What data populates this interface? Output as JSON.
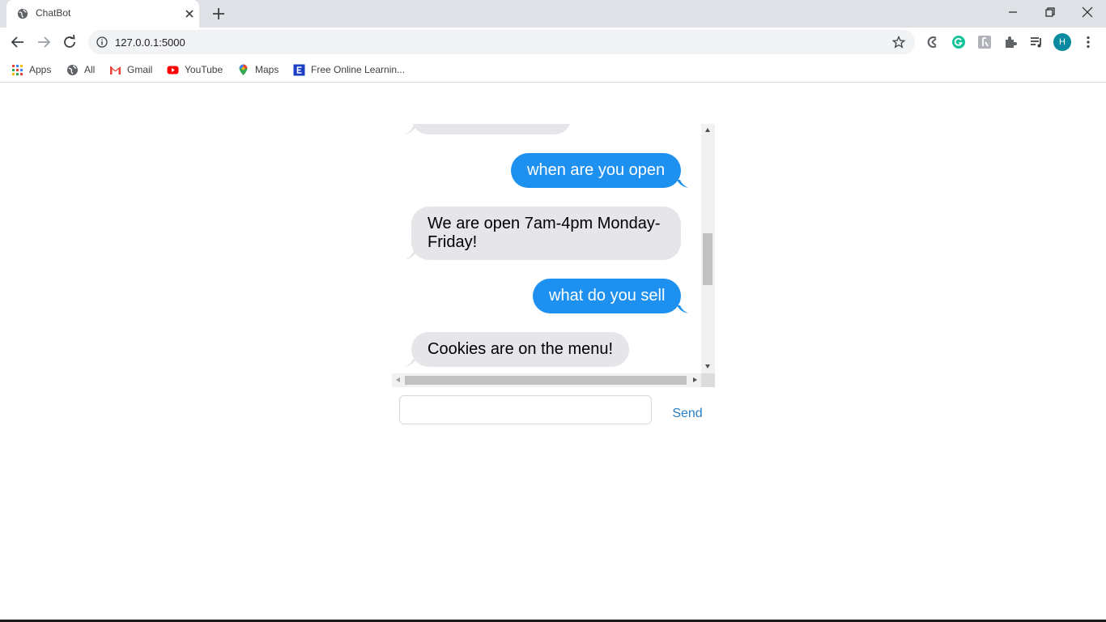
{
  "browser": {
    "tab_title": "ChatBot",
    "url": "127.0.0.1:5000",
    "avatar_letter": "H"
  },
  "bookmarks": [
    {
      "label": "Apps",
      "icon": "apps-grid-icon"
    },
    {
      "label": "All",
      "icon": "globe-icon"
    },
    {
      "label": "Gmail",
      "icon": "gmail-icon"
    },
    {
      "label": "YouTube",
      "icon": "youtube-icon"
    },
    {
      "label": "Maps",
      "icon": "maps-pin-icon"
    },
    {
      "label": "Free Online Learnin...",
      "icon": "learning-site-icon"
    }
  ],
  "chat": {
    "messages": [
      {
        "sender": "bot",
        "text": ""
      },
      {
        "sender": "user",
        "text": "when are you open"
      },
      {
        "sender": "bot",
        "text": "We are open 7am-4pm Monday-Friday!"
      },
      {
        "sender": "user",
        "text": "what do you sell"
      },
      {
        "sender": "bot",
        "text": "Cookies are on the menu!"
      }
    ],
    "input_value": "",
    "send_label": "Send"
  },
  "colors": {
    "user_bubble": "#1e90f0",
    "bot_bubble": "#e5e5ea",
    "send_link": "#2a7ec5"
  }
}
